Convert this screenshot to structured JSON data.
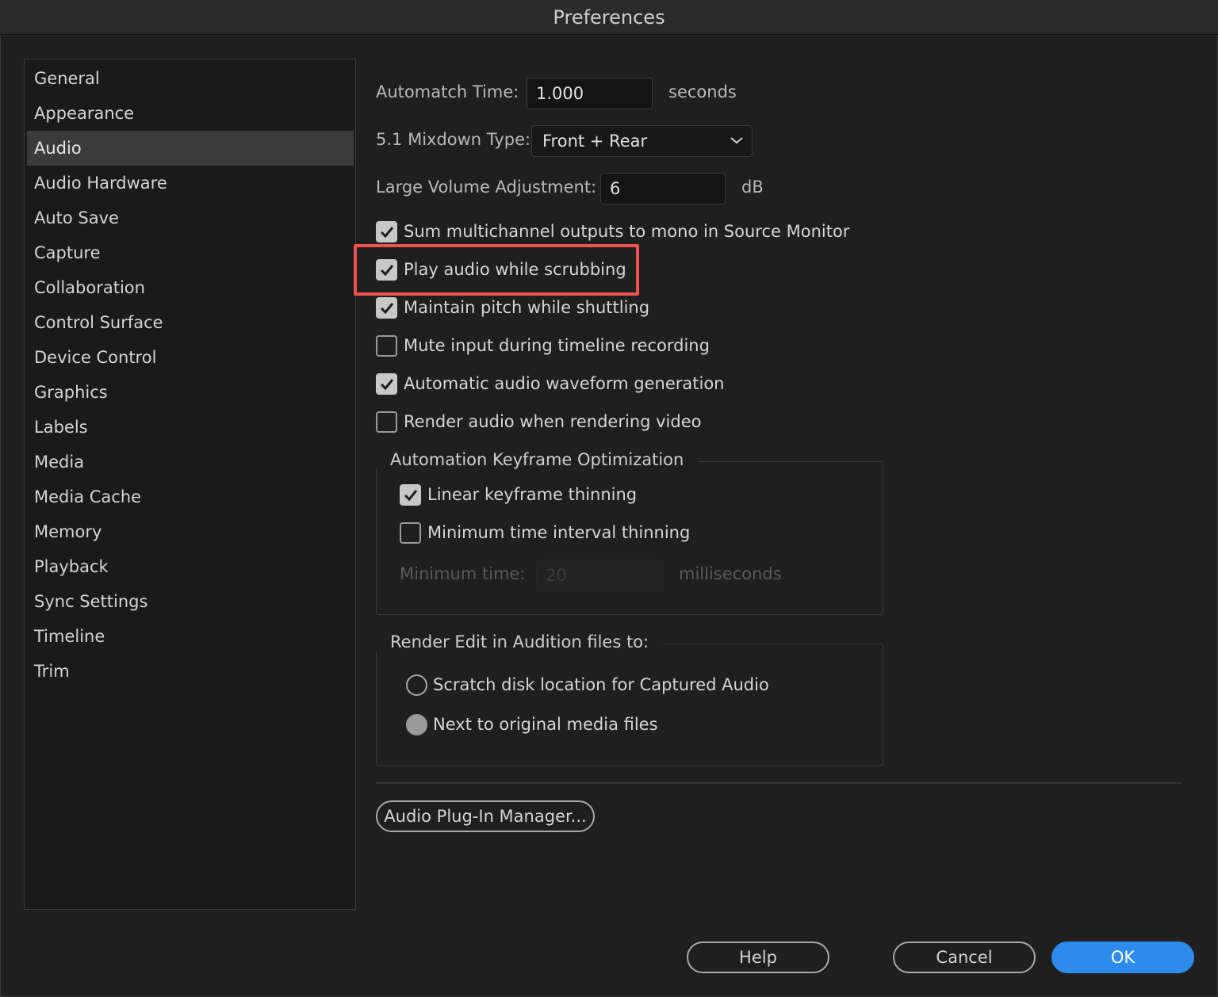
{
  "window": {
    "title": "Preferences"
  },
  "sidebar": {
    "items": [
      {
        "label": "General",
        "selected": false
      },
      {
        "label": "Appearance",
        "selected": false
      },
      {
        "label": "Audio",
        "selected": true
      },
      {
        "label": "Audio Hardware",
        "selected": false
      },
      {
        "label": "Auto Save",
        "selected": false
      },
      {
        "label": "Capture",
        "selected": false
      },
      {
        "label": "Collaboration",
        "selected": false
      },
      {
        "label": "Control Surface",
        "selected": false
      },
      {
        "label": "Device Control",
        "selected": false
      },
      {
        "label": "Graphics",
        "selected": false
      },
      {
        "label": "Labels",
        "selected": false
      },
      {
        "label": "Media",
        "selected": false
      },
      {
        "label": "Media Cache",
        "selected": false
      },
      {
        "label": "Memory",
        "selected": false
      },
      {
        "label": "Playback",
        "selected": false
      },
      {
        "label": "Sync Settings",
        "selected": false
      },
      {
        "label": "Timeline",
        "selected": false
      },
      {
        "label": "Trim",
        "selected": false
      }
    ]
  },
  "audio": {
    "automatch": {
      "label": "Automatch Time:",
      "value": "1.000",
      "unit": "seconds"
    },
    "mixdown": {
      "label": "5.1 Mixdown Type:",
      "value": "Front + Rear"
    },
    "large_volume": {
      "label": "Large Volume Adjustment:",
      "value": "6",
      "unit": "dB"
    },
    "checkboxes": [
      {
        "label": "Sum multichannel outputs to mono in Source Monitor",
        "checked": true
      },
      {
        "label": "Play audio while scrubbing",
        "checked": true,
        "highlighted": true
      },
      {
        "label": "Maintain pitch while shuttling",
        "checked": true
      },
      {
        "label": "Mute input during timeline recording",
        "checked": false
      },
      {
        "label": "Automatic audio waveform generation",
        "checked": true
      },
      {
        "label": "Render audio when rendering video",
        "checked": false
      }
    ],
    "keyframe_group": {
      "title": "Automation Keyframe Optimization",
      "linear": {
        "label": "Linear keyframe thinning",
        "checked": true
      },
      "min_interval": {
        "label": "Minimum time interval thinning",
        "checked": false
      },
      "min_time": {
        "label": "Minimum time:",
        "value": "20",
        "unit": "milliseconds"
      }
    },
    "render_group": {
      "title": "Render Edit in Audition files to:",
      "options": [
        {
          "label": "Scratch disk location for Captured Audio",
          "selected": false
        },
        {
          "label": "Next to original media files",
          "selected": true
        }
      ]
    },
    "plugin_manager_label": "Audio Plug-In Manager..."
  },
  "footer": {
    "help_label": "Help",
    "cancel_label": "Cancel",
    "ok_label": "OK"
  },
  "colors": {
    "accent": "#2d8ceb",
    "highlight": "#f0524f"
  }
}
